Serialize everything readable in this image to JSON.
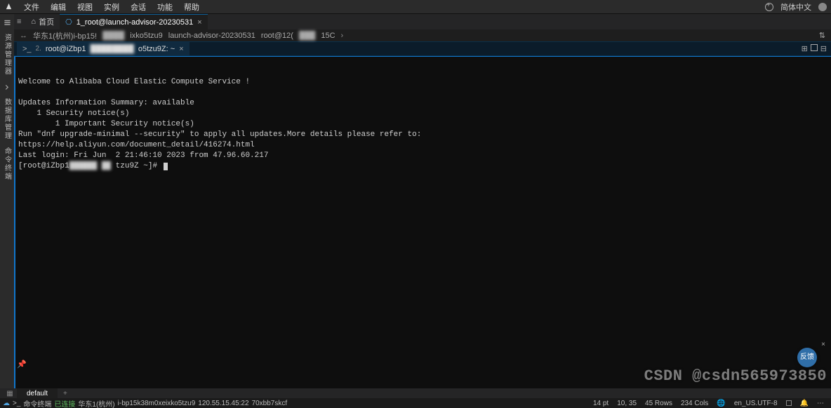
{
  "menu": {
    "items": [
      "文件",
      "编辑",
      "视图",
      "实例",
      "会话",
      "功能",
      "帮助"
    ]
  },
  "topright": {
    "lang": "简体中文"
  },
  "sidebar": {
    "labels": [
      "资源管理器",
      "数据库管理",
      "命令终端"
    ]
  },
  "tabs": {
    "home_label": "首页",
    "file_tab_label": "1_root@launch-advisor-20230531"
  },
  "breadcrumb": {
    "region": "华东1(杭州)i-bp15!",
    "inst_suffix": "ixko5tzu9",
    "host": "launch-advisor-20230531",
    "user": "root@12(",
    "mode": "15C"
  },
  "terminal_tab": {
    "index": "2.",
    "label": "root@iZbp1",
    "suffix": "o5tzu9Z: ~"
  },
  "terminal": {
    "welcome": "Welcome to Alibaba Cloud Elastic Compute Service !",
    "updates_header": "Updates Information Summary: available",
    "sec_notice": "    1 Security notice(s)",
    "imp_notice": "        1 Important Security notice(s)",
    "run_line": "Run \"dnf upgrade-minimal --security\" to apply all updates.More details please refer to:",
    "help_url": "https://help.aliyun.com/document_detail/416274.html",
    "last_login": "Last login: Fri Jun  2 21:46:10 2023 from 47.96.60.217",
    "prompt_prefix": "[root@iZbp1",
    "prompt_suffix": "tzu9Z ~]#"
  },
  "fab": {
    "label": "反馈"
  },
  "bottom_tabs": {
    "active": "default"
  },
  "status": {
    "term": "命令终端",
    "conn": "已连接",
    "region": "华东1(杭州)",
    "instance": "i-bp15k38m0xeixko5tzu9",
    "ip": "120.55.15.45:22",
    "hash": "70xbb7skcf",
    "fontsize": "14 pt",
    "cursor": "10, 35",
    "rows": "45 Rows",
    "cols": "234 Cols",
    "encoding": "en_US.UTF-8"
  },
  "watermark": "CSDN @csdn565973850"
}
